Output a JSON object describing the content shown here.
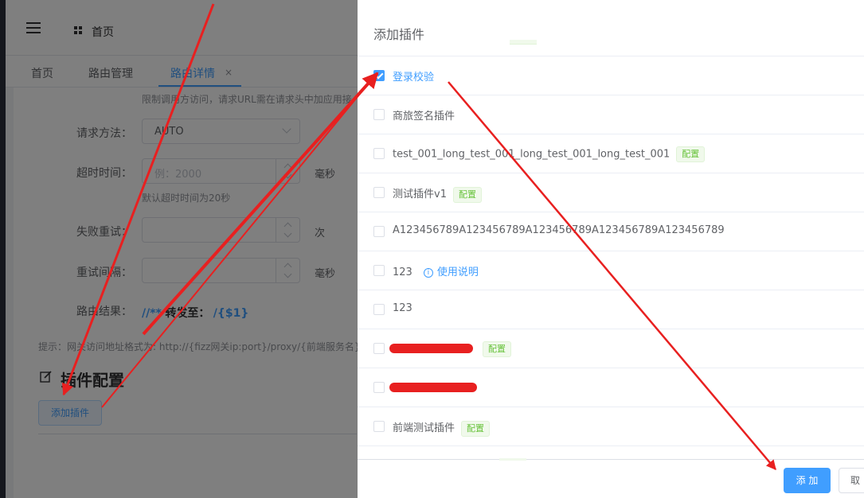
{
  "header": {
    "home_title": "首页"
  },
  "tabs": [
    {
      "label": "首页"
    },
    {
      "label": "路由管理"
    },
    {
      "label": "路由详情",
      "close": "×"
    }
  ],
  "form": {
    "top_hint": "限制调用方访问，请求URL需在请求头中加应用接",
    "method_label": "请求方法：",
    "method_value": "AUTO",
    "timeout_label": "超时时间：",
    "timeout_placeholder": "例：2000",
    "timeout_unit": "毫秒",
    "timeout_hint": "默认超时时间为20秒",
    "retry_label": "失败重试：",
    "retry_unit": "次",
    "interval_label": "重试间隔：",
    "interval_unit": "毫秒",
    "route_label": "路由结果：",
    "route_src": "//**",
    "route_mid": "转发至：",
    "route_dst": "/{$1}",
    "tip": "提示：网关访问地址格式为: http://{fizz网关ip:port}/proxy/{前端服务名}/{前端",
    "plugin_section_title": "插件配置",
    "add_plugin_button": "添加插件"
  },
  "drawer": {
    "title": "添加插件",
    "plugins": [
      {
        "name": "登录校验",
        "checked": true,
        "tag": ""
      },
      {
        "name": "商旅签名插件",
        "checked": false,
        "tag": ""
      },
      {
        "name": "test_001_long_test_001_long_test_001_long_test_001",
        "checked": false,
        "tag": "配置"
      },
      {
        "name": "测试插件v1",
        "checked": false,
        "tag": "配置"
      },
      {
        "name": "A123456789A123456789A123456789A123456789A123456789",
        "checked": false,
        "tag": ""
      },
      {
        "name": "123",
        "checked": false,
        "tag": "",
        "usage": "使用说明"
      },
      {
        "name": "123",
        "checked": false,
        "tag": ""
      },
      {
        "name": "",
        "checked": false,
        "tag": "配置",
        "redacted": true
      },
      {
        "name": "",
        "checked": false,
        "tag": "",
        "redacted": true
      },
      {
        "name": "前端测试插件",
        "checked": false,
        "tag": "配置"
      }
    ],
    "confirm_button": "添 加",
    "cancel_button": "取"
  },
  "colors": {
    "primary": "#409eff",
    "success": "#67c23a",
    "annotation": "#e82020"
  }
}
